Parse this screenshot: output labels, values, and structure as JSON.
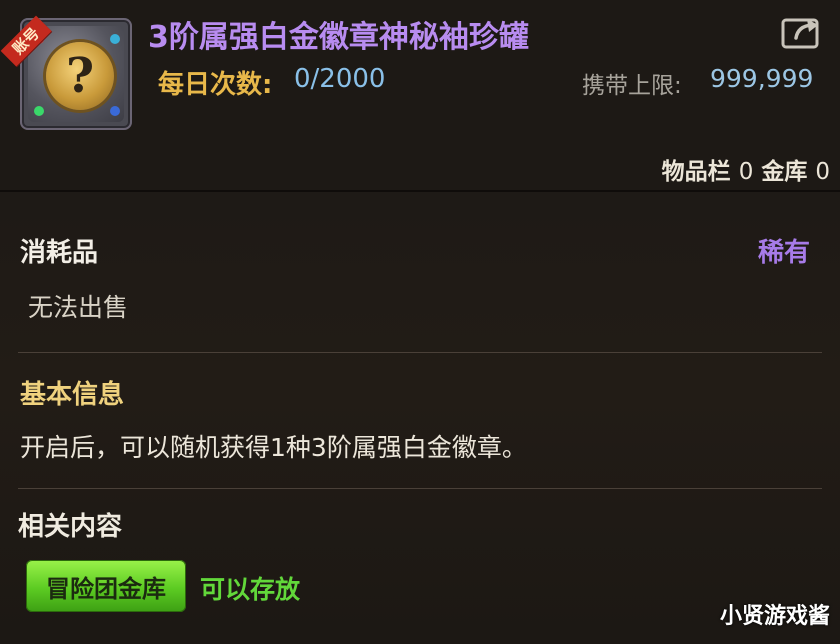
{
  "item": {
    "title": "3阶属强白金徽章神秘袖珍罐",
    "icon_badge": "账号",
    "icon_glyph": "?",
    "daily_label": "每日次数:",
    "daily_value": "0/2000",
    "carry_label": "携带上限:",
    "carry_value": "999,999",
    "inventory_label": "物品栏",
    "inventory_count": "0",
    "vault_label": "金库",
    "vault_count": "0"
  },
  "details": {
    "type_label": "消耗品",
    "rarity": "稀有",
    "sell_status": "无法出售",
    "basic_info_label": "基本信息",
    "description": "开启后，可以随机获得1种3阶属强白金徽章。",
    "related_label": "相关内容",
    "guild_vault_button": "冒险团金库",
    "storable_text": "可以存放"
  },
  "watermark": "小贤游戏酱",
  "colors": {
    "title": "#b88cf0",
    "rarity": "#a77be8",
    "daily_label": "#e8b84a",
    "value_blue": "#8ac0e8",
    "basic_info": "#f0d27e",
    "button_green": "#5ccb22",
    "storable_green": "#62d83a"
  },
  "icons": {
    "share": "share-external-icon",
    "item": "mystery-coin-icon"
  }
}
